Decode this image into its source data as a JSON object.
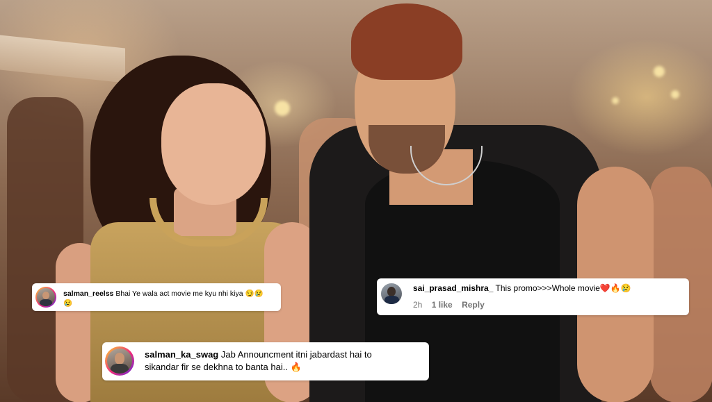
{
  "comments": [
    {
      "username": "salman_reelss",
      "text_line1": "Bhai Ye wala act movie me kyu nhi kiya 😏😢",
      "text_line2": "😢"
    },
    {
      "username": "sai_prasad_mishra_",
      "text": "This promo>>>Whole movie❤️🔥😢",
      "time": "2h",
      "likes": "1 like",
      "reply": "Reply"
    },
    {
      "username": "salman_ka_swag",
      "text_line1": "Jab Announcment itni jabardast hai to",
      "text_line2": "sikandar fir se dekhna to banta hai.. 🔥"
    }
  ],
  "colors": {
    "comment_bg": "#ffffff",
    "meta_text": "#737373",
    "story_ring": [
      "#f9ce34",
      "#ee2a7b",
      "#6228d7"
    ]
  }
}
